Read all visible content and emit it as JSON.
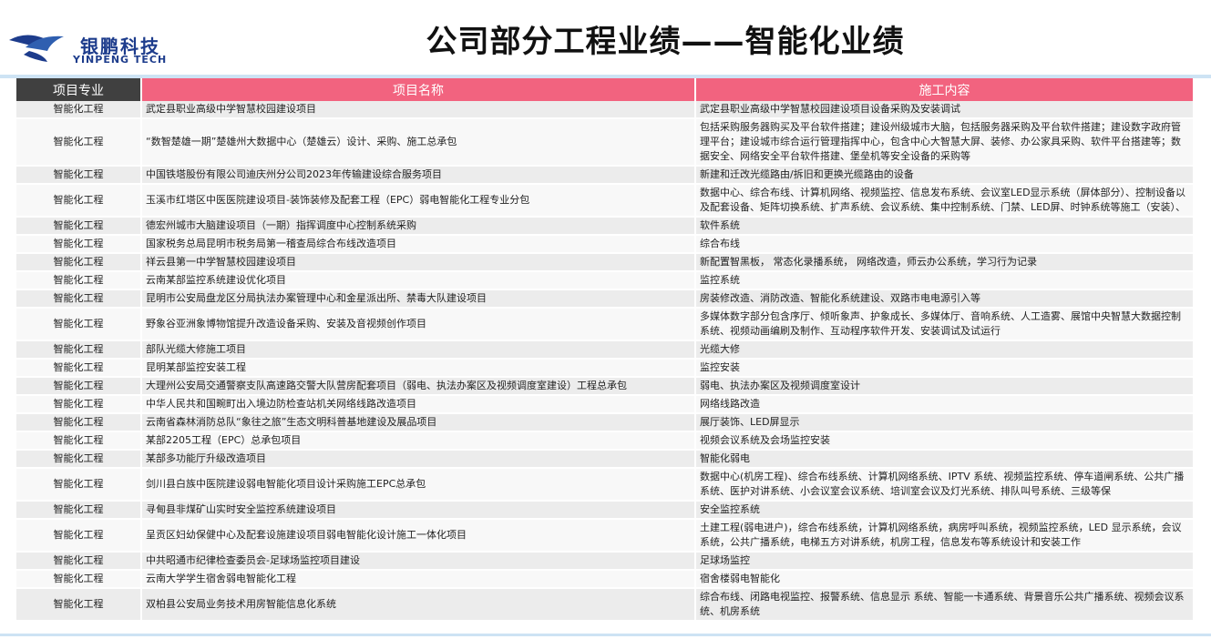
{
  "brand": {
    "name_cn": "银鹏科技",
    "name_en": "YINPENG TECH",
    "color": "#1d3c8c"
  },
  "title": "公司部分工程业绩——智能化业绩",
  "table": {
    "headers": [
      "项目专业",
      "项目名称",
      "施工内容"
    ],
    "rows": [
      [
        "智能化工程",
        "武定县职业高级中学智慧校园建设项目",
        "武定县职业高级中学智慧校园建设项目设备采购及安装调试"
      ],
      [
        "智能化工程",
        "“数智楚雄一期”楚雄州大数据中心（楚雄云）设计、采购、施工总承包",
        "包括采购服务器购买及平台软件搭建；建设州级城市大脑，包括服务器采购及平台软件搭建；建设数字政府管理平台；建设城市综合运行管理指挥中心，包含中心大智慧大屏、装修、办公家具采购、软件平台搭建等；数据安全、网络安全平台软件搭建、堡垒机等安全设备的采购等"
      ],
      [
        "智能化工程",
        "中国铁塔股份有限公司迪庆州分公司2023年传输建设综合服务项目",
        "新建和迁改光缆路由/拆旧和更换光缆路由的设备"
      ],
      [
        "智能化工程",
        "玉溪市红塔区中医医院建设项目-装饰装修及配套工程（EPC）弱电智能化工程专业分包",
        "数据中心、综合布线、计算机网络、视频监控、信息发布系统、会议室LED显示系统（屏体部分）、控制设备以及配套设备、矩阵切换系统、扩声系统、会议系统、集中控制系统、门禁、LED屏、时钟系统等施工（安装）、"
      ],
      [
        "智能化工程",
        "德宏州城市大脑建设项目（一期）指挥调度中心控制系统采购",
        "软件系统"
      ],
      [
        "智能化工程",
        "国家税务总局昆明市税务局第一稽查局综合布线改造项目",
        "综合布线"
      ],
      [
        "智能化工程",
        "祥云县第一中学智慧校园建设项目",
        "新配置智黑板， 常态化录播系统， 网络改造，师云办公系统，学习行为记录"
      ],
      [
        "智能化工程",
        "云南某部监控系统建设优化项目",
        "监控系统"
      ],
      [
        "智能化工程",
        "昆明市公安局盘龙区分局执法办案管理中心和金星派出所、禁毒大队建设项目",
        "房装修改造、消防改造、智能化系统建设、双路市电电源引入等"
      ],
      [
        "智能化工程",
        "野象谷亚洲象博物馆提升改造设备采购、安装及音视频创作项目",
        "多媒体数字部分包含序厅、倾听象声、护象成长、多媒体厅、音响系统、人工造雾、展馆中央智慧大数据控制系统、视频动画编刷及制作、互动程序软件开发、安装调试及试运行"
      ],
      [
        "智能化工程",
        "部队光缆大修施工项目",
        "光缆大修"
      ],
      [
        "智能化工程",
        "昆明某部监控安装工程",
        "监控安装"
      ],
      [
        "智能化工程",
        "大理州公安局交通警察支队高速路交警大队营房配套项目（弱电、执法办案区及视频调度室建设）工程总承包",
        "弱电、执法办案区及视频调度室设计"
      ],
      [
        "智能化工程",
        "中华人民共和国畹町出入境边防检查站机关网络线路改造项目",
        "网络线路改造"
      ],
      [
        "智能化工程",
        "云南省森林消防总队“象往之旅”生态文明科普基地建设及展品项目",
        "展厅装饰、LED屏显示"
      ],
      [
        "智能化工程",
        "某部2205工程（EPC）总承包项目",
        "视频会议系统及会场监控安装"
      ],
      [
        "智能化工程",
        "某部多功能厅升级改造项目",
        "智能化弱电"
      ],
      [
        "智能化工程",
        "剑川县白族中医院建设弱电智能化项目设计采购施工EPC总承包",
        "数据中心(机房工程)、综合布线系统、计算机网络系统、IPTV 系统、视频监控系统、停车道闸系统、公共广播系统、医护对讲系统、小会议室会议系统、培训室会议及灯光系统、排队叫号系统、三级等保"
      ],
      [
        "智能化工程",
        "寻甸县非煤矿山实时安全监控系统建设项目",
        "安全监控系统"
      ],
      [
        "智能化工程",
        "呈贡区妇幼保健中心及配套设施建设项目弱电智能化设计施工一体化项目",
        "土建工程(弱电进户)，综合布线系统，计算机网络系统，病房呼叫系统，视频监控系统，LED 显示系统，会议系统，公共广播系统，电梯五方对讲系统，机房工程，信息发布等系统设计和安装工作"
      ],
      [
        "智能化工程",
        "中共昭通市纪律检查委员会-足球场监控项目建设",
        "足球场监控"
      ],
      [
        "智能化工程",
        "云南大学学生宿舍弱电智能化工程",
        "宿舍楼弱电智能化"
      ],
      [
        "智能化工程",
        "双柏县公安局业务技术用房智能信息化系统",
        "综合布线、闭路电视监控、报警系统、信息显示 系统、智能一卡通系统、背景音乐公共广播系统、视频会议系统、机房系统"
      ]
    ]
  }
}
